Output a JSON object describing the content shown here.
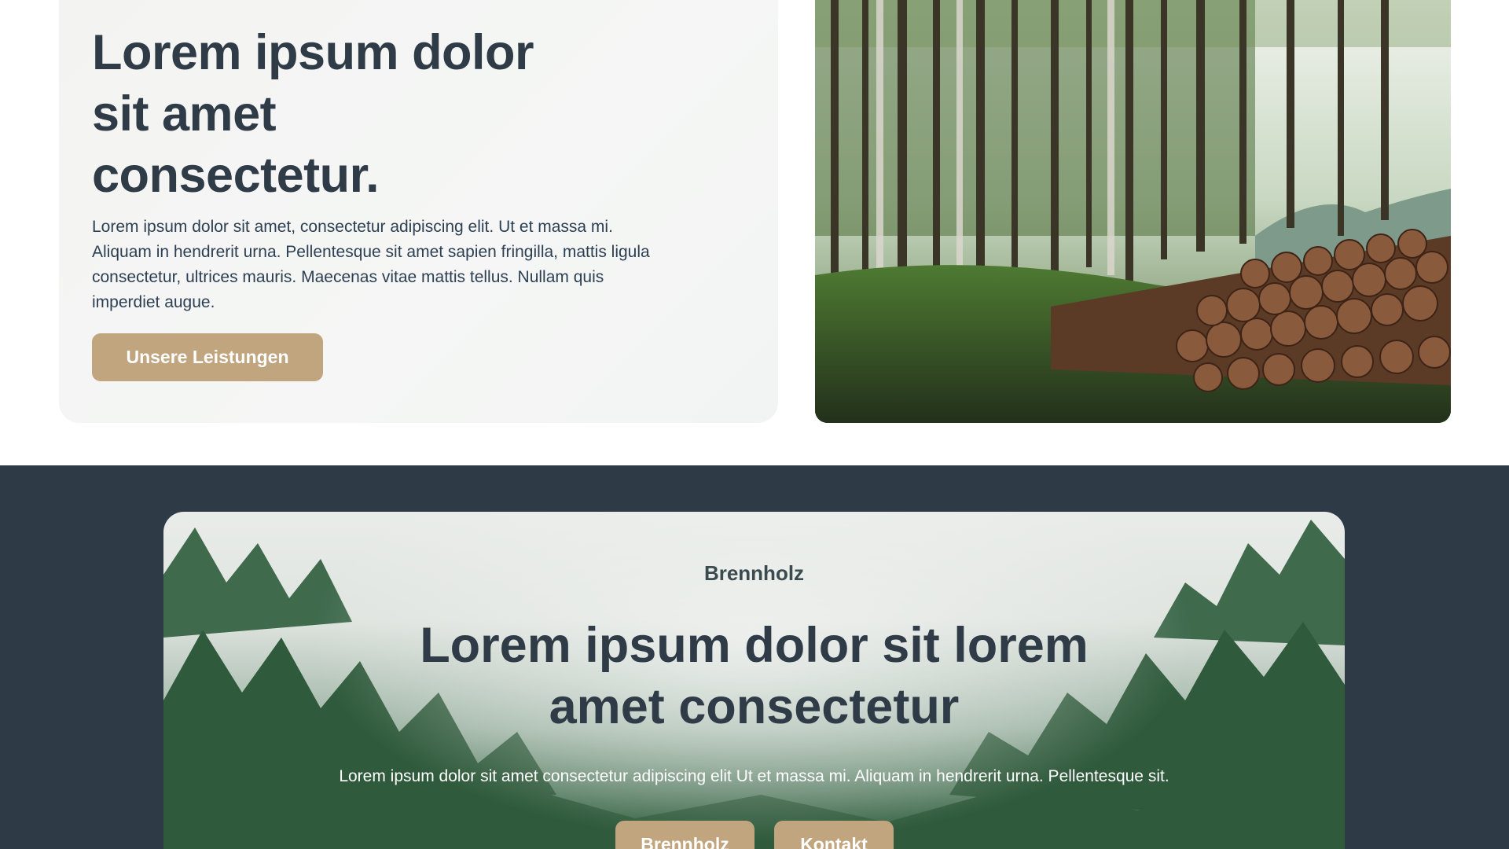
{
  "hero": {
    "title_line1": "Lorem ipsum dolor",
    "title_line2": "sit amet",
    "title_line3": "consectetur.",
    "text": "Lorem ipsum dolor sit amet, consectetur adipiscing elit. Ut et massa mi. Aliquam in hendrerit urna. Pellentesque sit amet sapien fringilla, mattis ligula consectetur, ultrices mauris. Maecenas vitae mattis tellus. Nullam quis imperdiet augue.",
    "button_label": "Unsere Leistungen"
  },
  "band": {
    "eyebrow": "Brennholz",
    "title_line1": "Lorem ipsum dolor sit lorem",
    "title_line2": "amet consectetur",
    "text": "Lorem ipsum dolor sit amet consectetur adipiscing elit Ut et massa mi. Aliquam in hendrerit urna. Pellentesque sit.",
    "button1_label": "Brennholz",
    "button2_label": "Kontakt"
  },
  "colors": {
    "accent": "#c0a57e",
    "dark_bg": "#2e3b47",
    "heading": "#2f3b47",
    "card_bg": "#f3f4f2"
  }
}
